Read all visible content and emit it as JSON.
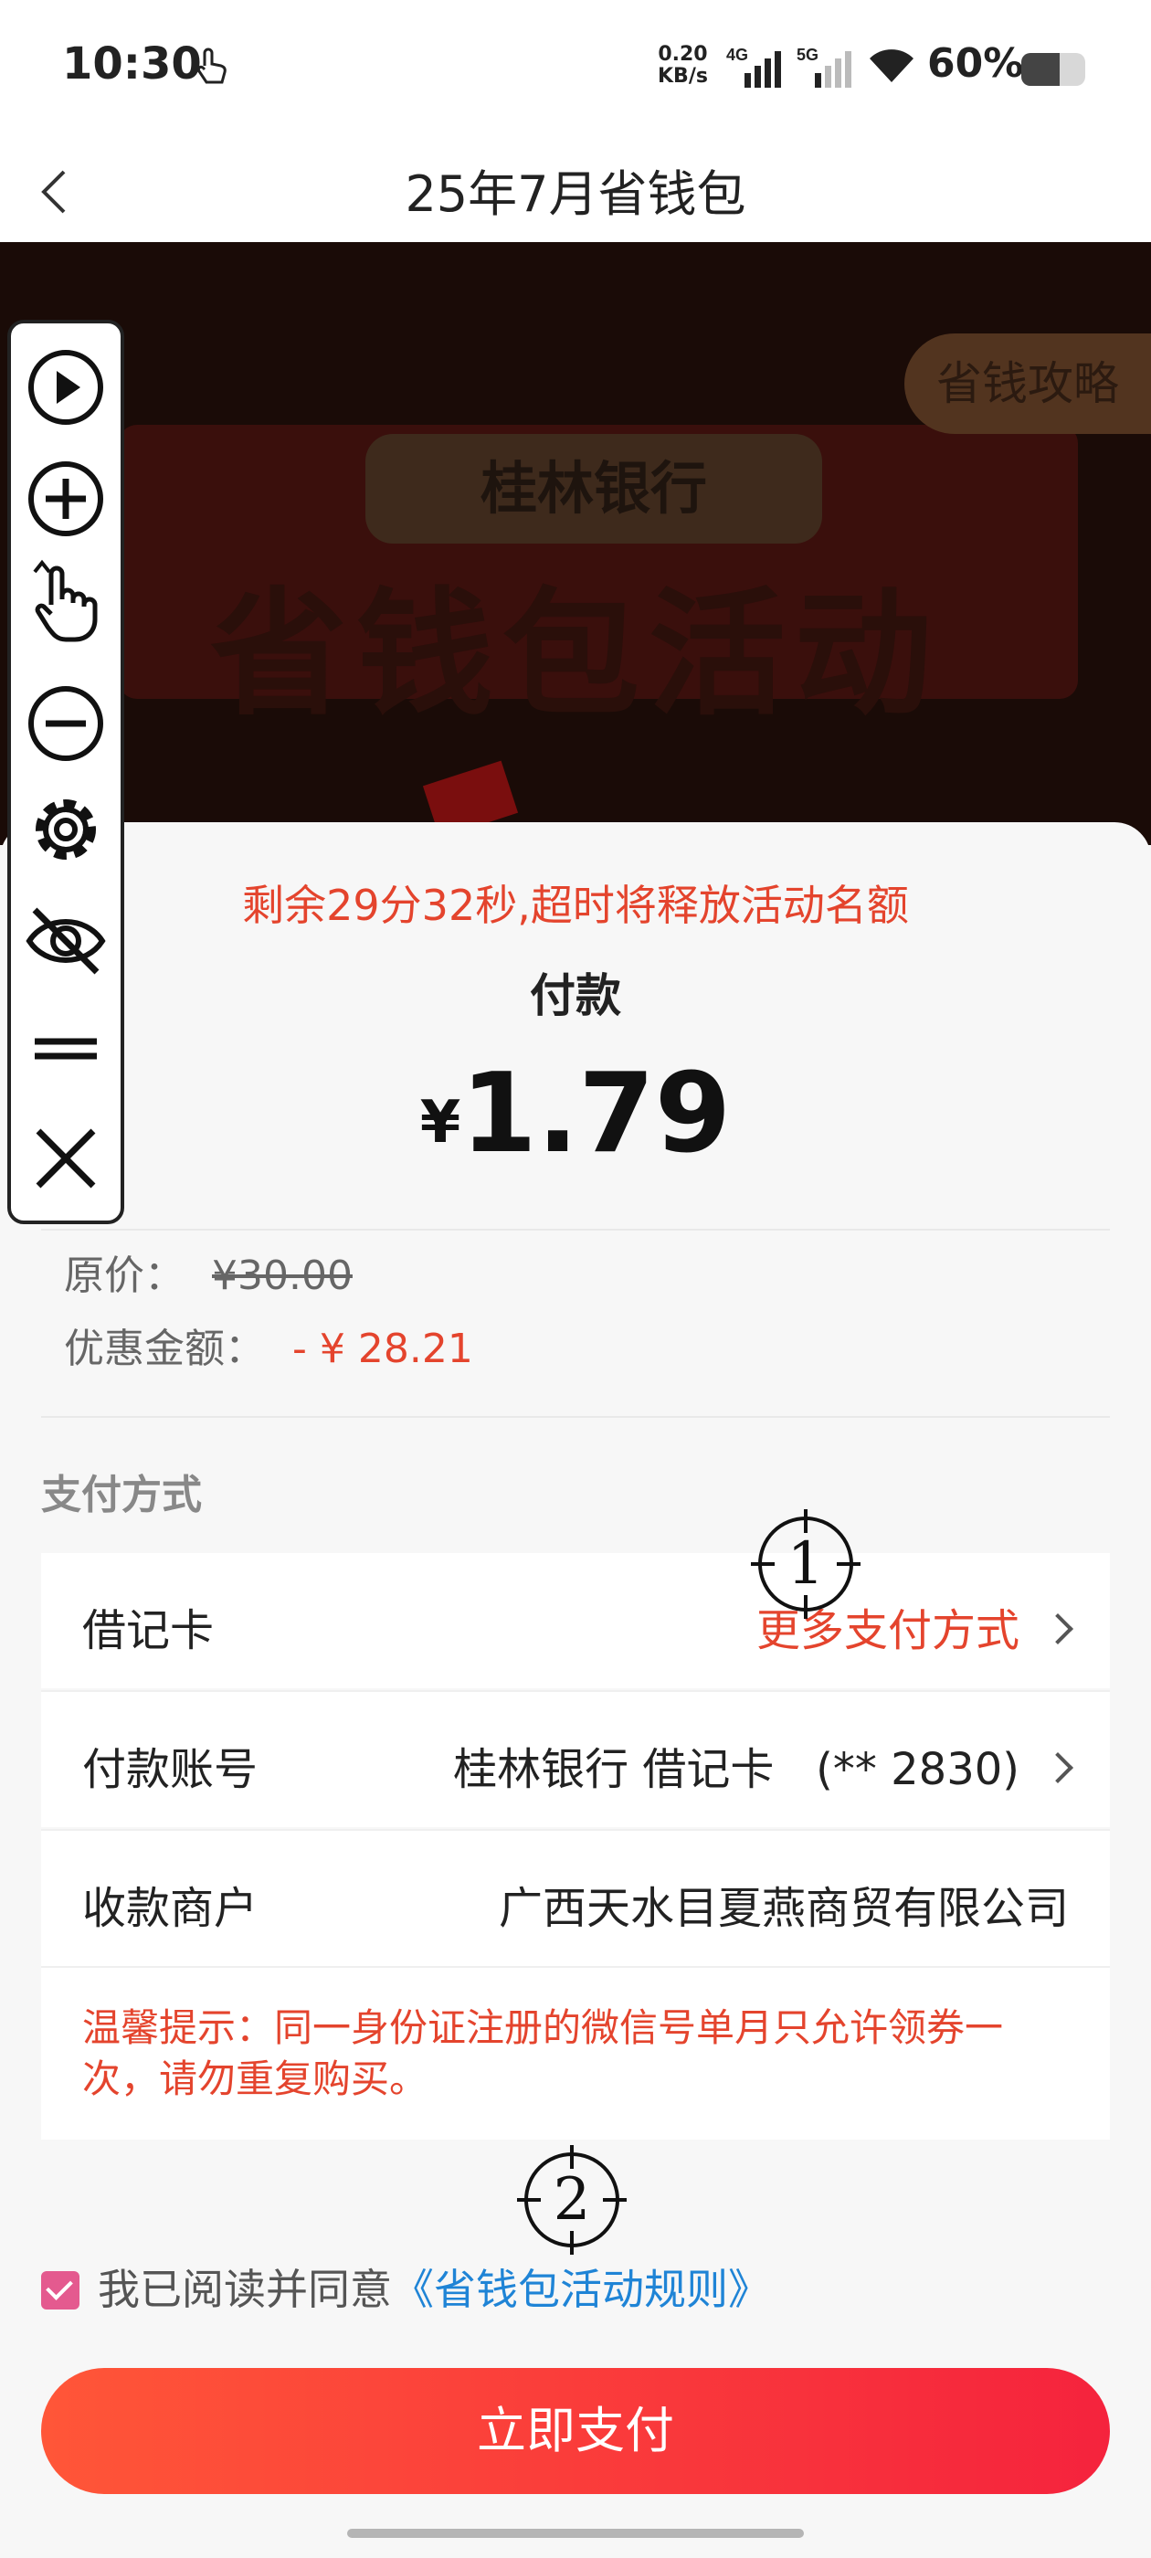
{
  "status_bar": {
    "time": "10:30",
    "speed_value": "0.20",
    "speed_unit": "KB/s",
    "net1": "4G",
    "net2": "5G",
    "battery": "60%",
    "battery_level": 0.6
  },
  "nav": {
    "title": "25年7月省钱包"
  },
  "banner": {
    "bank_name": "桂林银行",
    "headline": "省钱包活动",
    "guide_button": "省钱攻略"
  },
  "payment": {
    "countdown": "剩余29分32秒,超时将释放活动名额",
    "label": "付款",
    "currency": "¥",
    "amount": "1.79",
    "original_price_label": "原价：",
    "original_price": "¥30.00",
    "discount_label": "优惠金额：",
    "discount": "- ¥ 28.21"
  },
  "pay_method": {
    "section_title": "支付方式",
    "rows": [
      {
        "label": "借记卡",
        "value": "更多支付方式"
      },
      {
        "label": "付款账号",
        "value": "桂林银行 借记卡   (** 2830)"
      },
      {
        "label": "收款商户",
        "value": "广西天水目夏燕商贸有限公司"
      }
    ],
    "tip": "温馨提示：同一身份证注册的微信号单月只允许领券一次，请勿重复购买。"
  },
  "agreement": {
    "prefix": "我已阅读并同意",
    "link": "《省钱包活动规则》",
    "checked": true
  },
  "pay_button": "立即支付",
  "markers": [
    "1",
    "2"
  ],
  "toolbar": {
    "icons": [
      "play-icon",
      "zoom-in-icon",
      "tap-gesture-icon",
      "zoom-out-icon",
      "gear-icon",
      "eye-off-icon",
      "menu-icon",
      "close-icon"
    ]
  },
  "colors": {
    "accent_red": "#e4442d",
    "link_blue": "#1f84d6",
    "button_start": "#ff5638",
    "button_end": "#f5233d"
  }
}
